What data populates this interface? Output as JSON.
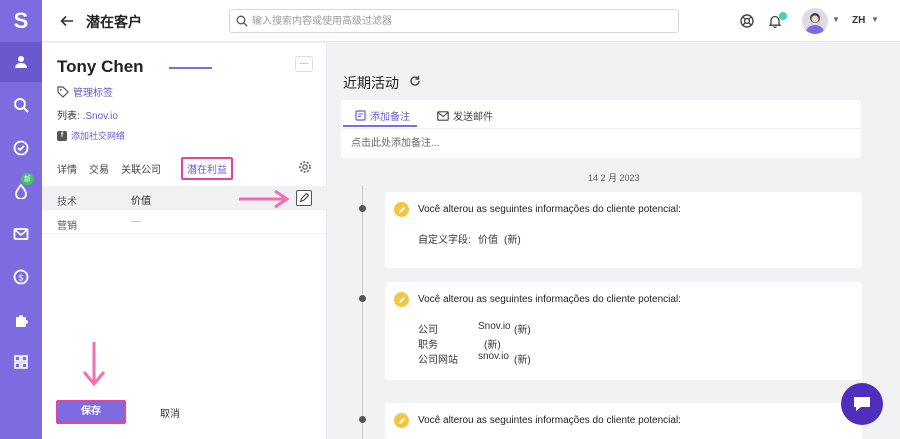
{
  "app": {
    "logo": "S"
  },
  "topbar": {
    "title": "潜在客户",
    "search_placeholder": "输入搜索内容或使用高级过滤器",
    "language": "ZH"
  },
  "contact": {
    "name": "Tony Chen",
    "manage_tags": "管理标签",
    "list_label": "列表:",
    "list_value": ".Snov.io",
    "add_social": "添加社交网络"
  },
  "tabs": [
    "详情",
    "交易",
    "关联公司",
    "潜在利益"
  ],
  "fields": [
    {
      "key": "技术",
      "value": "价值"
    },
    {
      "key": "营销",
      "value": "—"
    }
  ],
  "actions": {
    "save": "保存",
    "cancel": "取消",
    "more": "···"
  },
  "activity": {
    "title": "近期活动",
    "tab_note": "添加备注",
    "tab_email": "发送邮件",
    "note_placeholder": "点击此处添加备注...",
    "date": "14 2 月 2023",
    "items": [
      {
        "headline": "Você alterou as seguintes informações do cliente potencial:",
        "fields": [
          {
            "k": "自定义字段:",
            "v": "价值",
            "s": "(新)"
          }
        ]
      },
      {
        "headline": "Você alterou as seguintes informações do cliente potencial:",
        "fields": [
          {
            "k": "公司",
            "v": "Snov.io",
            "s": "(新)"
          },
          {
            "k": "职务",
            "v": "",
            "s": "(新)"
          },
          {
            "k": "公司网站",
            "v": "snov.io",
            "s": "(新)"
          }
        ]
      },
      {
        "headline": "Você alterou as seguintes informações do cliente potencial:",
        "fields": []
      }
    ]
  },
  "rail_badge": "新",
  "colors": {
    "accent": "#7d6be0",
    "highlight": "#e8429e",
    "chat": "#4f2dbd"
  }
}
